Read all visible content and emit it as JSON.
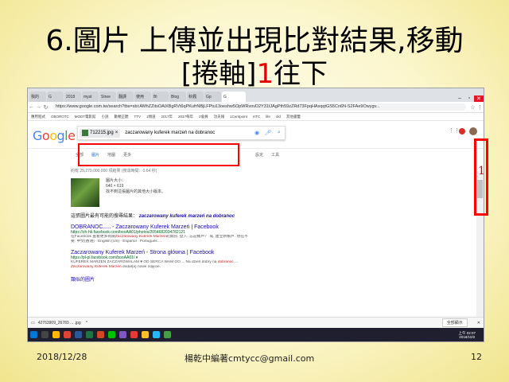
{
  "slide": {
    "title_line1": "6.圖片 上傳並出現比對結果,移動",
    "title_line2_a": "[捲軸]",
    "title_line2_num": "1",
    "title_line2_b": "往下",
    "date": "2018/12/28",
    "author": "楊乾中編著cmtycc@gmail.com",
    "page": "12"
  },
  "browser": {
    "tabs": [
      "我的",
      "G",
      "2018",
      "myst",
      "Stree",
      "翻譯",
      "使用",
      "Bl",
      "Blog",
      "秋楓",
      "Gp",
      "G"
    ],
    "url": "https://www.google.com.tw/search?tbs=sbi:AMhZZitsOAiXBgRVt6qPKufrNBjLFPtu13oeshw5OpWRvovD2Y31tJAgPth59zZRd73FpqHAxqqtGS5Cn6N-S2FAe9Owygv...",
    "bookmarks": [
      "應用程式",
      "OBOROTC",
      "MODT電影館",
      "小說",
      "數類正聽",
      "TTV",
      "1頻道",
      "2017年",
      "2017每年",
      "2會員",
      "功夫報",
      "1Centpoint",
      "HTC",
      "life",
      "old",
      "其他書籤"
    ]
  },
  "google": {
    "logo": "Google",
    "chip_file": "712215.jpg",
    "query": "zaczarowany kuferek marzeń na dobranoc",
    "tabs": [
      "全部",
      "圖片",
      "地圖",
      "更多"
    ],
    "tools": [
      "設定",
      "工具"
    ],
    "stats": "約有 25,270,000,000 項結果 (搜尋時間：0.64 秒)",
    "image_size_label": "圖片大小：",
    "image_size": "640 × 619",
    "no_other_sizes": "找不到這張圖片的其他大小版本。",
    "best_guess_label": "這張圖片最有可能的搜尋結果：",
    "best_guess": "zaczarowany kuferek marzeń na dobranoc",
    "results": [
      {
        "title": "DOBRANOC..... - Zaczarowany Kuferek Marzeń | Facebook",
        "cite": "https://zh-hk.facebook.com/booAA01/photos/2054682034782121",
        "snip1a": "在Facebook 查看更多有關",
        "snip1em": "Zaczarowany Kuferek Marzeń",
        "snip1b": "的資訊. 登入. 忘記帳戶？ 或. 建立新帳戶. 現在不",
        "snip2": "要. 中文(香港) · English (US) · Español · Português ..."
      },
      {
        "title": "Zaczarowany Kuferek Marzeń - Strona główna | Facebook",
        "cite": "https://pl-pl.facebook.com/booAA01/ ▾",
        "snip1a": "KUFEREK MARZEŃ ZACZAROWALAM ♥ OD SERCA WAM GO ... Na dzień dobry na ",
        "snip1em": "dobranoc",
        "snip1b": " ...",
        "snip2a_em": "Zaczarowany Kuferek Marzeń",
        "snip2b": " dodał(a) nowe zdjęcie."
      }
    ],
    "truncated_next": "類似的圖片"
  },
  "downloads": {
    "file": "42763909_26783 ... .jpg",
    "show_all": "全部顯示"
  },
  "taskbar": {
    "time": "上午 02:07",
    "date": "2018/10/2"
  },
  "colors": {
    "highlight_red": "#ff0000",
    "title_number_red": "#e00000",
    "link_blue": "#1a0dab",
    "url_green": "#006621"
  }
}
